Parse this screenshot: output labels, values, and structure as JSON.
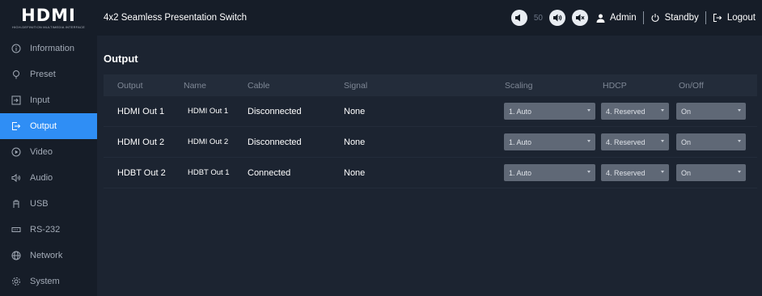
{
  "header": {
    "logo": "HDMI",
    "logo_sub": "HIGH-DEFINITION MULTIMEDIA INTERFACE",
    "title": "4x2 Seamless Presentation Switch",
    "volume_value": "50",
    "user": "Admin",
    "standby": "Standby",
    "logout": "Logout"
  },
  "sidebar": {
    "items": [
      {
        "label": "Information",
        "icon": "info-icon"
      },
      {
        "label": "Preset",
        "icon": "preset-icon"
      },
      {
        "label": "Input",
        "icon": "input-icon"
      },
      {
        "label": "Output",
        "icon": "output-icon"
      },
      {
        "label": "Video",
        "icon": "video-icon"
      },
      {
        "label": "Audio",
        "icon": "audio-icon"
      },
      {
        "label": "USB",
        "icon": "usb-icon"
      },
      {
        "label": "RS-232",
        "icon": "rs232-icon"
      },
      {
        "label": "Network",
        "icon": "network-icon"
      },
      {
        "label": "System",
        "icon": "system-icon"
      }
    ],
    "active": "Output"
  },
  "main": {
    "section_title": "Output",
    "columns": [
      "Output",
      "Name",
      "Cable",
      "Signal",
      "Scaling",
      "HDCP",
      "On/Off"
    ],
    "rows": [
      {
        "output": "HDMI Out 1",
        "name": "HDMI Out 1",
        "cable": "Disconnected",
        "signal": "None",
        "scaling": "1. Auto",
        "hdcp": "4. Reserved",
        "onoff": "On"
      },
      {
        "output": "HDMI Out 2",
        "name": "HDMI Out 2",
        "cable": "Disconnected",
        "signal": "None",
        "scaling": "1. Auto",
        "hdcp": "4. Reserved",
        "onoff": "On"
      },
      {
        "output": "HDBT Out 2",
        "name": "HDBT Out 1",
        "cable": "Connected",
        "signal": "None",
        "scaling": "1. Auto",
        "hdcp": "4. Reserved",
        "onoff": "On"
      }
    ]
  },
  "colors": {
    "accent": "#2f8ef5",
    "sidebar_bg": "#161d28",
    "main_bg": "#1c2431",
    "select_bg": "#5f6876"
  }
}
